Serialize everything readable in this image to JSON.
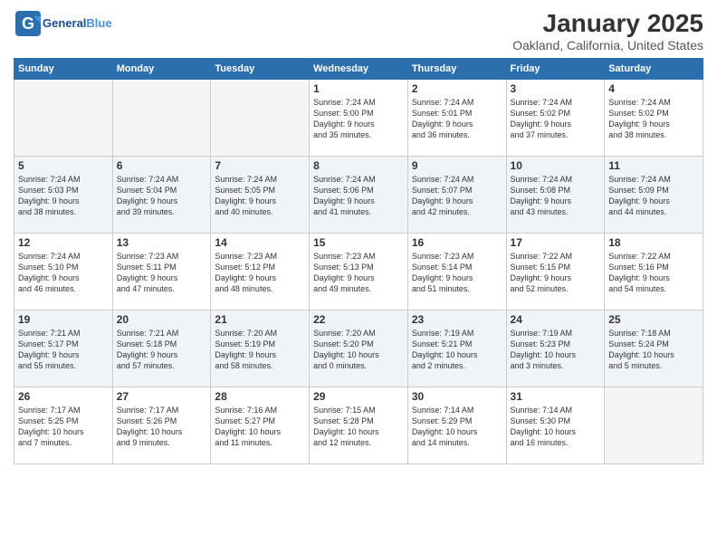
{
  "header": {
    "logo_line1": "General",
    "logo_line2": "Blue",
    "title": "January 2025",
    "subtitle": "Oakland, California, United States"
  },
  "weekdays": [
    "Sunday",
    "Monday",
    "Tuesday",
    "Wednesday",
    "Thursday",
    "Friday",
    "Saturday"
  ],
  "weeks": [
    [
      {
        "day": "",
        "info": ""
      },
      {
        "day": "",
        "info": ""
      },
      {
        "day": "",
        "info": ""
      },
      {
        "day": "1",
        "info": "Sunrise: 7:24 AM\nSunset: 5:00 PM\nDaylight: 9 hours\nand 35 minutes."
      },
      {
        "day": "2",
        "info": "Sunrise: 7:24 AM\nSunset: 5:01 PM\nDaylight: 9 hours\nand 36 minutes."
      },
      {
        "day": "3",
        "info": "Sunrise: 7:24 AM\nSunset: 5:02 PM\nDaylight: 9 hours\nand 37 minutes."
      },
      {
        "day": "4",
        "info": "Sunrise: 7:24 AM\nSunset: 5:02 PM\nDaylight: 9 hours\nand 38 minutes."
      }
    ],
    [
      {
        "day": "5",
        "info": "Sunrise: 7:24 AM\nSunset: 5:03 PM\nDaylight: 9 hours\nand 38 minutes."
      },
      {
        "day": "6",
        "info": "Sunrise: 7:24 AM\nSunset: 5:04 PM\nDaylight: 9 hours\nand 39 minutes."
      },
      {
        "day": "7",
        "info": "Sunrise: 7:24 AM\nSunset: 5:05 PM\nDaylight: 9 hours\nand 40 minutes."
      },
      {
        "day": "8",
        "info": "Sunrise: 7:24 AM\nSunset: 5:06 PM\nDaylight: 9 hours\nand 41 minutes."
      },
      {
        "day": "9",
        "info": "Sunrise: 7:24 AM\nSunset: 5:07 PM\nDaylight: 9 hours\nand 42 minutes."
      },
      {
        "day": "10",
        "info": "Sunrise: 7:24 AM\nSunset: 5:08 PM\nDaylight: 9 hours\nand 43 minutes."
      },
      {
        "day": "11",
        "info": "Sunrise: 7:24 AM\nSunset: 5:09 PM\nDaylight: 9 hours\nand 44 minutes."
      }
    ],
    [
      {
        "day": "12",
        "info": "Sunrise: 7:24 AM\nSunset: 5:10 PM\nDaylight: 9 hours\nand 46 minutes."
      },
      {
        "day": "13",
        "info": "Sunrise: 7:23 AM\nSunset: 5:11 PM\nDaylight: 9 hours\nand 47 minutes."
      },
      {
        "day": "14",
        "info": "Sunrise: 7:23 AM\nSunset: 5:12 PM\nDaylight: 9 hours\nand 48 minutes."
      },
      {
        "day": "15",
        "info": "Sunrise: 7:23 AM\nSunset: 5:13 PM\nDaylight: 9 hours\nand 49 minutes."
      },
      {
        "day": "16",
        "info": "Sunrise: 7:23 AM\nSunset: 5:14 PM\nDaylight: 9 hours\nand 51 minutes."
      },
      {
        "day": "17",
        "info": "Sunrise: 7:22 AM\nSunset: 5:15 PM\nDaylight: 9 hours\nand 52 minutes."
      },
      {
        "day": "18",
        "info": "Sunrise: 7:22 AM\nSunset: 5:16 PM\nDaylight: 9 hours\nand 54 minutes."
      }
    ],
    [
      {
        "day": "19",
        "info": "Sunrise: 7:21 AM\nSunset: 5:17 PM\nDaylight: 9 hours\nand 55 minutes."
      },
      {
        "day": "20",
        "info": "Sunrise: 7:21 AM\nSunset: 5:18 PM\nDaylight: 9 hours\nand 57 minutes."
      },
      {
        "day": "21",
        "info": "Sunrise: 7:20 AM\nSunset: 5:19 PM\nDaylight: 9 hours\nand 58 minutes."
      },
      {
        "day": "22",
        "info": "Sunrise: 7:20 AM\nSunset: 5:20 PM\nDaylight: 10 hours\nand 0 minutes."
      },
      {
        "day": "23",
        "info": "Sunrise: 7:19 AM\nSunset: 5:21 PM\nDaylight: 10 hours\nand 2 minutes."
      },
      {
        "day": "24",
        "info": "Sunrise: 7:19 AM\nSunset: 5:23 PM\nDaylight: 10 hours\nand 3 minutes."
      },
      {
        "day": "25",
        "info": "Sunrise: 7:18 AM\nSunset: 5:24 PM\nDaylight: 10 hours\nand 5 minutes."
      }
    ],
    [
      {
        "day": "26",
        "info": "Sunrise: 7:17 AM\nSunset: 5:25 PM\nDaylight: 10 hours\nand 7 minutes."
      },
      {
        "day": "27",
        "info": "Sunrise: 7:17 AM\nSunset: 5:26 PM\nDaylight: 10 hours\nand 9 minutes."
      },
      {
        "day": "28",
        "info": "Sunrise: 7:16 AM\nSunset: 5:27 PM\nDaylight: 10 hours\nand 11 minutes."
      },
      {
        "day": "29",
        "info": "Sunrise: 7:15 AM\nSunset: 5:28 PM\nDaylight: 10 hours\nand 12 minutes."
      },
      {
        "day": "30",
        "info": "Sunrise: 7:14 AM\nSunset: 5:29 PM\nDaylight: 10 hours\nand 14 minutes."
      },
      {
        "day": "31",
        "info": "Sunrise: 7:14 AM\nSunset: 5:30 PM\nDaylight: 10 hours\nand 16 minutes."
      },
      {
        "day": "",
        "info": ""
      }
    ]
  ]
}
